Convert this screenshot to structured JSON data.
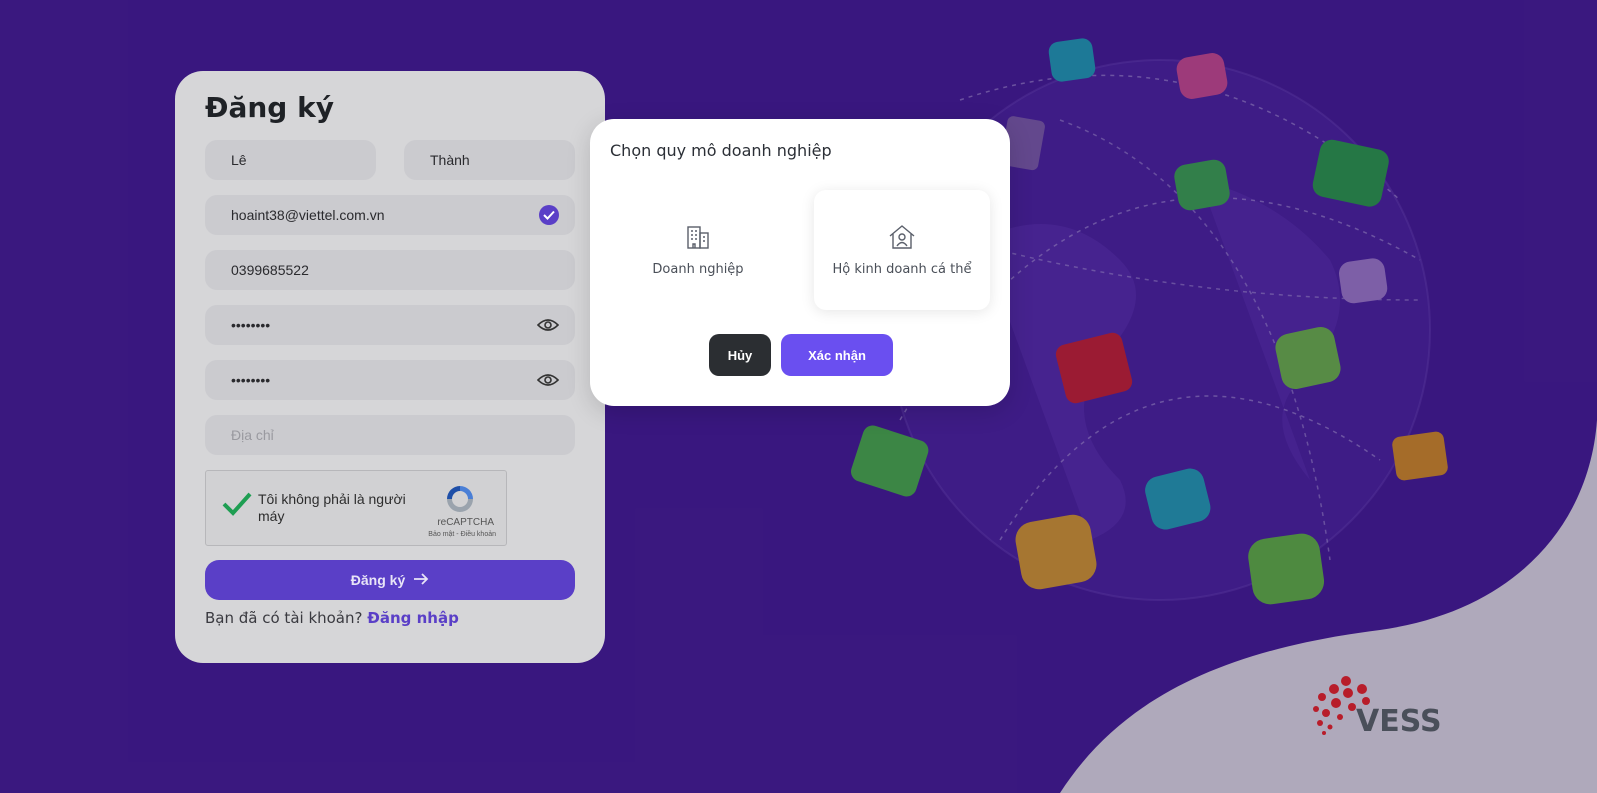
{
  "register": {
    "title": "Đăng ký",
    "first_name": "Lê",
    "last_name": "Thành",
    "email": "hoaint38@viettel.com.vn",
    "phone": "0399685522",
    "password": "••••••••",
    "confirm_password": "••••••••",
    "address_placeholder": "Địa chỉ",
    "captcha_text": "Tôi không phải là người máy",
    "captcha_brand": "reCAPTCHA",
    "captcha_terms": "Bảo mật - Điều khoản",
    "submit_label": "Đăng ký",
    "have_account_text": "Bạn đã có tài khoản?",
    "login_link": "Đăng nhập"
  },
  "modal": {
    "title": "Chọn quy mô doanh nghiệp",
    "option_enterprise": "Doanh nghiệp",
    "option_household": "Hộ kinh doanh cá thể",
    "cancel_label": "Hủy",
    "confirm_label": "Xác nhận"
  },
  "brand": {
    "name": "VESS"
  },
  "colors": {
    "background": "#4b1fa3",
    "accent": "#5a3fc7",
    "confirm": "#6a4ff0",
    "cancel": "#2b2e32"
  },
  "icons": [
    "check-circle-icon",
    "eye-icon",
    "recaptcha-icon",
    "arrow-right-icon",
    "building-icon",
    "house-user-icon"
  ]
}
